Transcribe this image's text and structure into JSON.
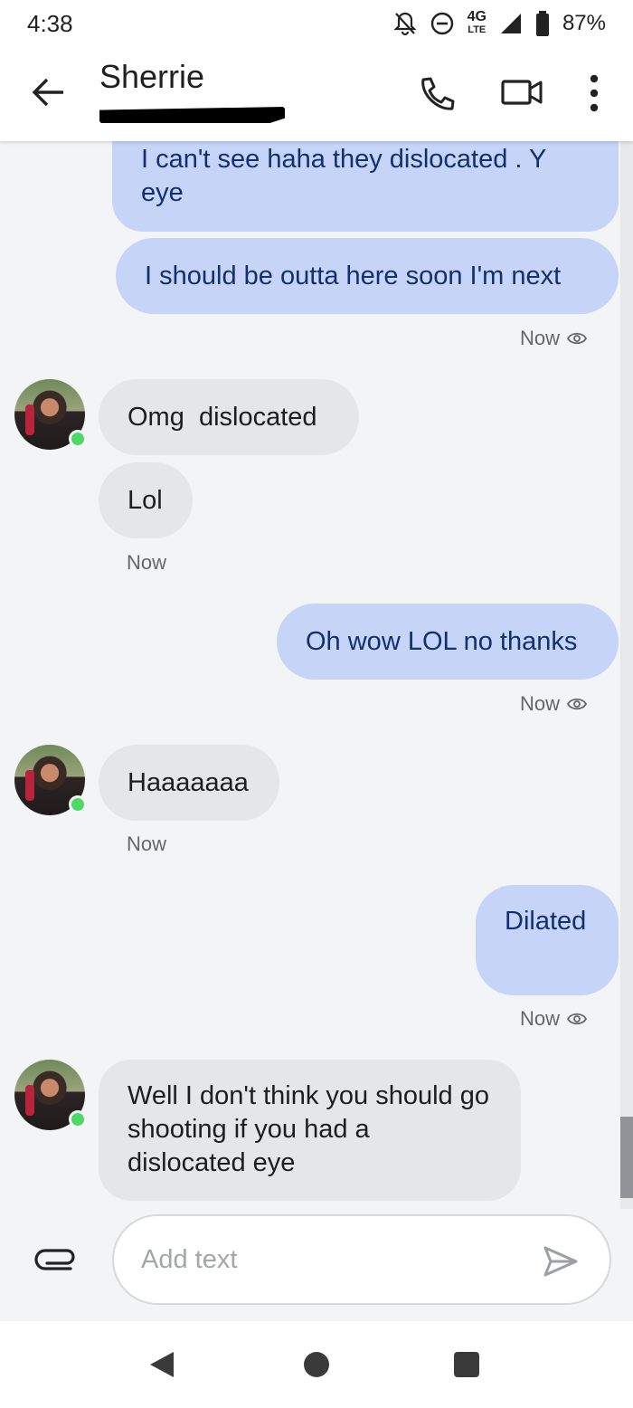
{
  "status_bar": {
    "time": "4:38",
    "network": "4G",
    "network_sub": "LTE",
    "battery": "87%"
  },
  "header": {
    "contact_name": "Sherrie"
  },
  "messages": [
    {
      "direction": "outgoing",
      "text": "I can't see haha they dislocated . Y eye"
    },
    {
      "direction": "outgoing",
      "text": "I should be outta here soon I'm next"
    },
    {
      "type": "meta",
      "text": "Now"
    },
    {
      "direction": "incoming",
      "text": "Omg  dislocated"
    },
    {
      "direction": "incoming",
      "text": "Lol"
    },
    {
      "type": "meta",
      "text": "Now"
    },
    {
      "direction": "outgoing",
      "text": "Oh wow LOL no thanks"
    },
    {
      "type": "meta",
      "text": "Now"
    },
    {
      "direction": "incoming",
      "text": "Haaaaaaa"
    },
    {
      "type": "meta",
      "text": "Now"
    },
    {
      "direction": "outgoing",
      "text": "Dilated"
    },
    {
      "type": "meta",
      "text": "Now"
    },
    {
      "direction": "incoming",
      "text": "Well I don't think you should go shooting if you had a dislocated eye"
    }
  ],
  "composer": {
    "placeholder": "Add text"
  },
  "colors": {
    "outgoing_bubble": "#c5d4f7",
    "incoming_bubble": "#e5e6e8",
    "online_dot": "#4cd964"
  }
}
